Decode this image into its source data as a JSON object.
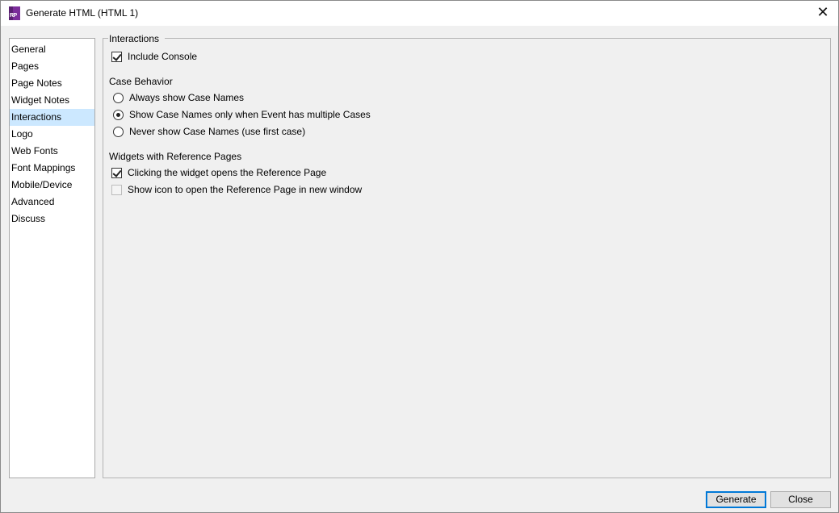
{
  "window": {
    "title": "Generate HTML (HTML 1)",
    "app_icon_text": "RP",
    "close_glyph": "✕"
  },
  "nav": {
    "items": [
      {
        "label": "General"
      },
      {
        "label": "Pages"
      },
      {
        "label": "Page Notes"
      },
      {
        "label": "Widget Notes"
      },
      {
        "label": "Interactions"
      },
      {
        "label": "Logo"
      },
      {
        "label": "Web Fonts"
      },
      {
        "label": "Font Mappings"
      },
      {
        "label": "Mobile/Device"
      },
      {
        "label": "Advanced"
      },
      {
        "label": "Discuss"
      }
    ],
    "selected": "Interactions"
  },
  "panel": {
    "group_title": "Interactions",
    "include_console": {
      "label": "Include Console",
      "checked": true
    },
    "case_behavior": {
      "label": "Case Behavior",
      "options": [
        {
          "label": "Always show Case Names",
          "selected": false
        },
        {
          "label": "Show Case Names only when Event has multiple Cases",
          "selected": true
        },
        {
          "label": "Never show Case Names (use first case)",
          "selected": false
        }
      ]
    },
    "reference_pages": {
      "label": "Widgets with Reference Pages",
      "options": [
        {
          "label": "Clicking the widget opens the Reference Page",
          "checked": true
        },
        {
          "label": "Show icon to open the Reference Page in new window",
          "checked": false
        }
      ]
    }
  },
  "buttons": {
    "generate": "Generate",
    "close": "Close"
  },
  "colors": {
    "selected_item_bg": "#cce8ff",
    "app_icon": "#7b2d9a",
    "default_button_border": "#0078d7"
  }
}
